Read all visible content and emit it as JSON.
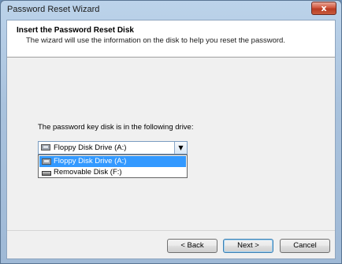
{
  "window": {
    "title": "Password Reset Wizard",
    "close_label": "x"
  },
  "header": {
    "title": "Insert the Password Reset Disk",
    "subtitle": "The wizard will use the information on the disk to help you reset the password."
  },
  "main": {
    "drive_label": "The password key disk is in the following drive:",
    "drive_select": {
      "selected": "Floppy Disk Drive (A:)",
      "arrow": "▼",
      "options": [
        {
          "label": "Floppy Disk Drive (A:)",
          "icon": "floppy-drive-icon",
          "highlighted": true
        },
        {
          "label": "Removable Disk (F:)",
          "icon": "removable-disk-icon",
          "highlighted": false
        }
      ]
    }
  },
  "buttons": {
    "back": "< Back",
    "next": "Next >",
    "cancel": "Cancel"
  },
  "colors": {
    "selection": "#3399ff",
    "close": "#c9452c"
  }
}
